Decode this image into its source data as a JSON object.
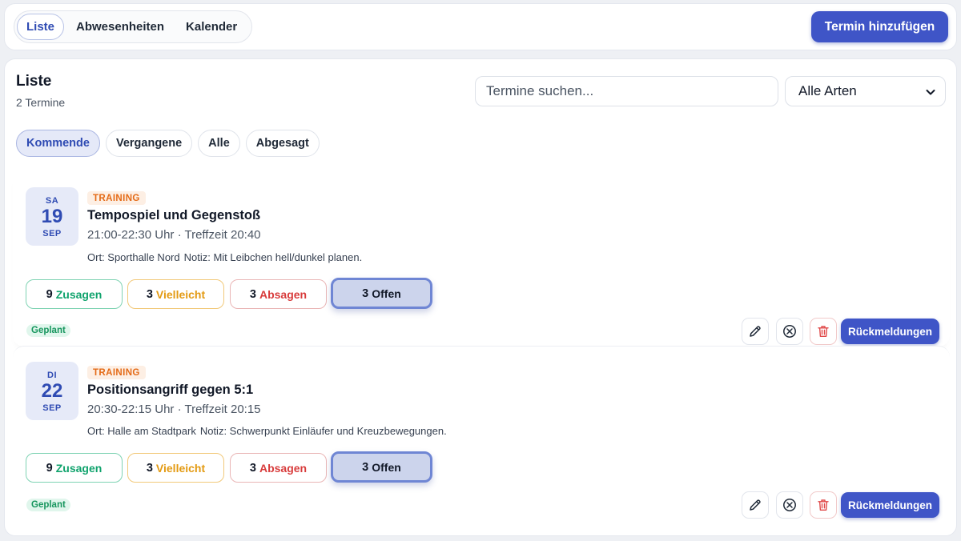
{
  "view_tabs": [
    {
      "label": "Liste",
      "active": true
    },
    {
      "label": "Abwesenheiten",
      "active": false
    },
    {
      "label": "Kalender",
      "active": false
    }
  ],
  "add_button": "Termin hinzufügen",
  "panel": {
    "title": "Liste",
    "count": "2 Termine",
    "search_placeholder": "Termine suchen...",
    "type_select": {
      "selected": "Alle Arten"
    }
  },
  "filters": [
    {
      "label": "Kommende",
      "active": true
    },
    {
      "label": "Vergangene",
      "active": false
    },
    {
      "label": "Alle",
      "active": false
    },
    {
      "label": "Abgesagt",
      "active": false
    }
  ],
  "events": [
    {
      "dow": "SA",
      "day": "19",
      "month": "SEP",
      "type": "TRAINING",
      "title": "Tempospiel und Gegenstoß",
      "time": "21:00-22:30 Uhr · Treffzeit 20:40",
      "location": "Ort: Sporthalle Nord",
      "note": "Notiz: Mit Leibchen hell/dunkel planen.",
      "rsvp": {
        "yes_count": "9",
        "yes_label": "Zusagen",
        "maybe_count": "3",
        "maybe_label": "Vielleicht",
        "no_count": "3",
        "no_label": "Absagen",
        "open_count": "3",
        "open_label": "Offen"
      },
      "status": "Geplant",
      "feedback_label": "Rückmeldungen"
    },
    {
      "dow": "DI",
      "day": "22",
      "month": "SEP",
      "type": "TRAINING",
      "title": "Positionsangriff gegen 5:1",
      "time": "20:30-22:15 Uhr · Treffzeit 20:15",
      "location": "Ort: Halle am Stadtpark",
      "note": "Notiz: Schwerpunkt Einläufer und Kreuzbewegungen.",
      "rsvp": {
        "yes_count": "9",
        "yes_label": "Zusagen",
        "maybe_count": "3",
        "maybe_label": "Vielleicht",
        "no_count": "3",
        "no_label": "Absagen",
        "open_count": "3",
        "open_label": "Offen"
      },
      "status": "Geplant",
      "feedback_label": "Rückmeldungen"
    }
  ],
  "colors": {
    "accent": "#3f55c7",
    "training_orange": "#e46b17",
    "yes_green": "#10a36d",
    "maybe_amber": "#e39a12",
    "no_red": "#d83c3c",
    "planned_green": "#17965e"
  },
  "icons": [
    "pencil-icon",
    "cancel-circle-icon",
    "trash-icon",
    "chevron-down-icon"
  ]
}
